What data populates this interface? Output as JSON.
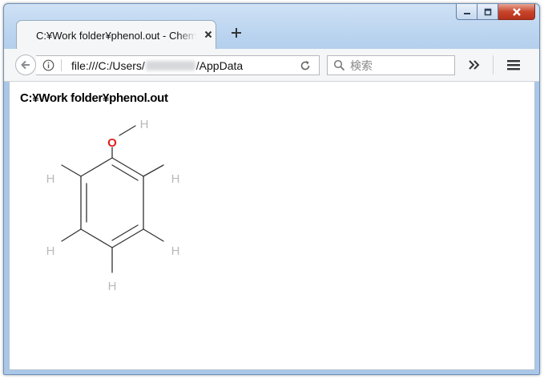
{
  "tab": {
    "title": "C:¥Work folder¥phenol.out - Chemical Viewer"
  },
  "address": {
    "url_prefix": "file:///C:/Users/",
    "url_suffix": "/AppData"
  },
  "search": {
    "placeholder": "検索"
  },
  "page": {
    "title": "C:¥Work folder¥phenol.out"
  },
  "molecule": {
    "atoms": [
      {
        "id": "O",
        "label": "O",
        "color": "#e0201f"
      },
      {
        "id": "H-hydroxyl",
        "label": "H",
        "color": "#b9b9b9"
      },
      {
        "id": "H-upper-left",
        "label": "H",
        "color": "#b9b9b9"
      },
      {
        "id": "H-upper-right",
        "label": "H",
        "color": "#b9b9b9"
      },
      {
        "id": "H-lower-left",
        "label": "H",
        "color": "#b9b9b9"
      },
      {
        "id": "H-lower-right",
        "label": "H",
        "color": "#b9b9b9"
      },
      {
        "id": "H-bottom",
        "label": "H",
        "color": "#b9b9b9"
      }
    ]
  },
  "colors": {
    "window_chrome": "#b9d3ef",
    "close_button": "#c8452b",
    "bond": "#333333"
  }
}
